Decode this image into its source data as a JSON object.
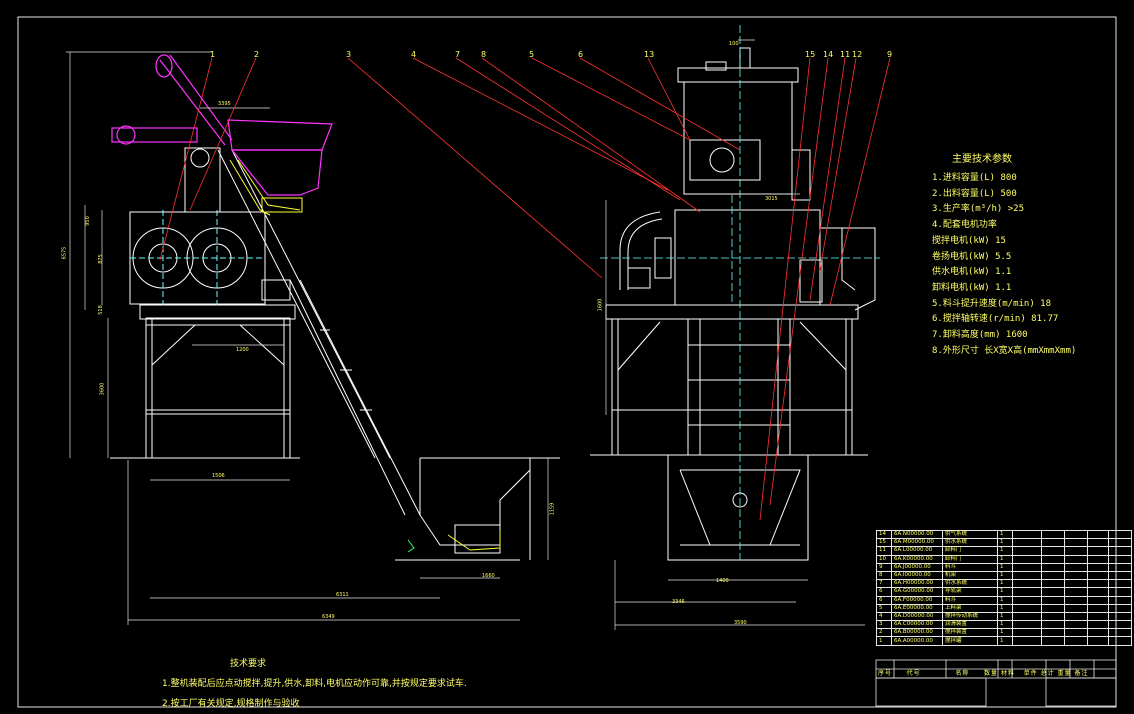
{
  "drawing": {
    "callouts": [
      "1",
      "2",
      "3",
      "4",
      "7",
      "8",
      "5",
      "6",
      "13",
      "15",
      "14",
      "11",
      "12",
      "9"
    ],
    "dims": {
      "top_width": "3395",
      "top_plat": "1200",
      "leg_span": "1506",
      "hopper_h": "1159",
      "hopper_w": "1660",
      "len1": "6311",
      "len2": "6349",
      "h_total": "6575",
      "h_tank": "1600",
      "h_body": "950",
      "h_frame": "3600",
      "h_mid": "875",
      "h_low": "518",
      "side_top": "100",
      "side_w": "1400",
      "side_w2": "3346",
      "side_w3": "3590",
      "side_mid": "3015"
    }
  },
  "params": {
    "title": "主要技术参数",
    "rows": [
      "1.进料容量(L)   800",
      "2.出料容量(L)   500",
      "3.生产率(m³/h)  >25",
      "4.配套电机功率",
      "  搅拌电机(kW)  15",
      "  卷扬电机(kW)  5.5",
      "  供水电机(kW)  1.1",
      "  卸料电机(kW)  1.1",
      "5.料斗提升速度(m/min)  18",
      "6.搅拌轴转速(r/min)  81.77",
      "7.卸料高度(mm)    1600",
      "8.外形尺寸 长X宽X高(mmXmmXmm)"
    ]
  },
  "notes": {
    "title": "技术要求",
    "items": [
      "1.整机装配后应点动搅拌,提升,供水,卸料,电机应动作可靠,并按规定要求试车.",
      "2.按工厂有关规定,规格制作与验收"
    ]
  },
  "bom": {
    "rows": [
      [
        "14",
        "6A.N00000.00",
        "供气系统",
        "1"
      ],
      [
        "15",
        "6A.M00000.00",
        "供水系统",
        "1"
      ],
      [
        "11",
        "6A.L00000.00",
        "卸料门",
        "1"
      ],
      [
        "10",
        "6A.K00000.00",
        "卸料门",
        "1"
      ],
      [
        "9",
        "6A.J00000.00",
        "料斗",
        "1"
      ],
      [
        "8",
        "6A.I00000.00",
        "机架",
        "1"
      ],
      [
        "7",
        "6A.H00000.00",
        "供水系统",
        "1"
      ],
      [
        "6",
        "6A.G00000.00",
        "导轨架",
        "1"
      ],
      [
        "6",
        "6A.F00000.00",
        "料斗",
        "1"
      ],
      [
        "5",
        "6A.E00000.00",
        "上料架",
        "1"
      ],
      [
        "4",
        "6A.D00000.00",
        "搅拌传动系统",
        "1"
      ],
      [
        "3",
        "6A.C00000.00",
        "润滑装置",
        "1"
      ],
      [
        "2",
        "6A.B00000.00",
        "搅拌装置",
        "1"
      ],
      [
        "1",
        "6A.A00000.00",
        "搅拌罐",
        "1"
      ]
    ],
    "header": [
      "序号",
      "代号",
      "名称",
      "数量",
      "材料",
      "单件",
      "总计",
      "重量",
      "备注"
    ]
  }
}
